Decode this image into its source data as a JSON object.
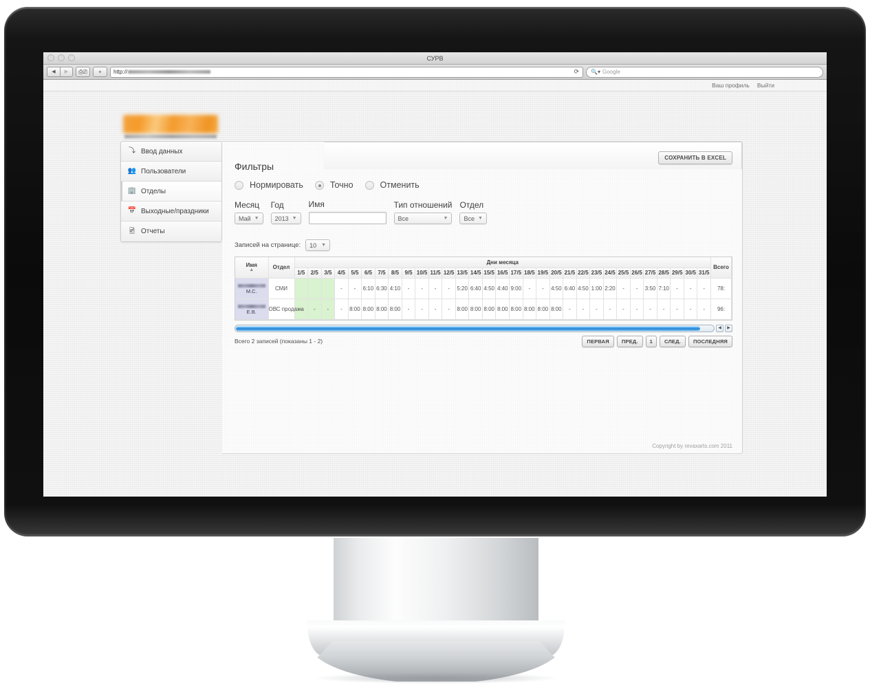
{
  "browser": {
    "window_title": "СУРВ",
    "back_icon": "back-arrow-icon",
    "forward_icon": "forward-arrow-icon",
    "reader_icon": "reader-icon",
    "add_tab_icon": "plus-icon",
    "url_value": "http://",
    "reload_icon": "reload-icon",
    "search_placeholder": "Google",
    "search_icon": "magnifier-icon"
  },
  "topbar": {
    "profile_link": "Ваш профиль",
    "logout_link": "Выйти"
  },
  "sidebar": {
    "items": [
      {
        "label": "Ввод данных",
        "icon": "arrow-down-right-icon",
        "glyph": "⤵",
        "active": false
      },
      {
        "label": "Пользователи",
        "icon": "users-icon",
        "glyph": "\u0001",
        "active": false
      },
      {
        "label": "Отделы",
        "icon": "building-icon",
        "glyph": "\u0001",
        "active": true
      },
      {
        "label": "Выходные/праздники",
        "icon": "calendar-icon",
        "glyph": "\u0001",
        "active": false
      },
      {
        "label": "Отчеты",
        "icon": "report-image-icon",
        "glyph": "\u0001",
        "active": false
      }
    ]
  },
  "toolbar": {
    "excel_label": "СОХРАНИТЬ В EXCEL"
  },
  "filters": {
    "title": "Фильтры",
    "radios": [
      {
        "label": "Нормировать",
        "checked": false
      },
      {
        "label": "Точно",
        "checked": true
      },
      {
        "label": "Отменить",
        "checked": false
      }
    ],
    "month": {
      "label": "Месяц",
      "value": "Май"
    },
    "year": {
      "label": "Год",
      "value": "2013"
    },
    "name": {
      "label": "Имя",
      "value": "",
      "placeholder": ""
    },
    "relation_type": {
      "label": "Тип отношений",
      "value": "Все"
    },
    "department": {
      "label": "Отдел",
      "value": "Все"
    }
  },
  "perpage": {
    "label": "Записей на странице:",
    "value": "10"
  },
  "table": {
    "headers": {
      "name": "Имя",
      "dept": "Отдел",
      "days_group": "Дни месяца",
      "total": "Всего"
    },
    "sort_column": "Имя",
    "sort_direction": "asc",
    "days": [
      "1/5",
      "2/5",
      "3/5",
      "4/5",
      "5/5",
      "6/5",
      "7/5",
      "8/5",
      "9/5",
      "10/5",
      "11/5",
      "12/5",
      "13/5",
      "14/5",
      "15/5",
      "16/5",
      "17/5",
      "18/5",
      "19/5",
      "20/5",
      "21/5",
      "22/5",
      "23/5",
      "24/5",
      "25/5",
      "26/5",
      "27/5",
      "28/5",
      "29/5",
      "30/5",
      "31/5"
    ],
    "holiday_days": [
      "1/5",
      "2/5",
      "3/5"
    ],
    "rows": [
      {
        "name_initials": "М.С.",
        "name_redacted": true,
        "dept": "СМИ",
        "values": [
          "",
          "",
          "",
          "-",
          "-",
          "6:10",
          "6:30",
          "4:10",
          "-",
          "-",
          "-",
          "-",
          "5:20",
          "6:40",
          "4:50",
          "4:40",
          "9:00",
          "-",
          "-",
          "4:50",
          "6:40",
          "4:50",
          "1:00",
          "2:20",
          "-",
          "-",
          "3:50",
          "7:10",
          "-",
          "-",
          "-"
        ],
        "total": "78:"
      },
      {
        "name_initials": "Е.В.",
        "name_redacted": true,
        "dept": "ОВС продажа",
        "values": [
          "-",
          "-",
          "-",
          "-",
          "8:00",
          "8:00",
          "8:00",
          "8:00",
          "-",
          "-",
          "-",
          "-",
          "8:00",
          "8:00",
          "8:00",
          "8:00",
          "8:00",
          "8:00",
          "8:00",
          "8:00",
          "-",
          "-",
          "-",
          "-",
          "-",
          "-",
          "-",
          "-",
          "-",
          "-",
          "-"
        ],
        "total": "96:"
      }
    ]
  },
  "footer": {
    "record_count": "Всего 2 записей (показаны 1 - 2)",
    "pager": [
      {
        "label": "ПЕРВАЯ",
        "kind": "nav"
      },
      {
        "label": "ПРЕД.",
        "kind": "nav"
      },
      {
        "label": "1",
        "kind": "num"
      },
      {
        "label": "СЛЕД.",
        "kind": "nav"
      },
      {
        "label": "ПОСЛЕДНЯЯ",
        "kind": "nav"
      }
    ],
    "copyright": "Copyright by revaxarts.com 2011"
  },
  "colors": {
    "holiday_cell": "#d9f2cf",
    "name_cell": "#dcdcef",
    "logo_orange": "#f59b28",
    "scrollbar_blue": "#2f8fe0"
  }
}
